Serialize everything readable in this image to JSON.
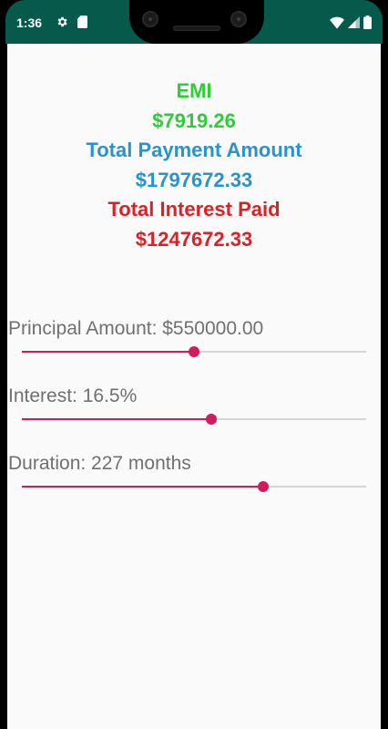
{
  "status_bar": {
    "time": "1:36",
    "icons": [
      "gear-icon",
      "sim-card-icon",
      "wifi-icon",
      "signal-icon",
      "battery-icon"
    ]
  },
  "results": {
    "emi_label": "EMI",
    "emi_value": "$7919.26",
    "total_payment_label": "Total Payment Amount",
    "total_payment_value": "$1797672.33",
    "total_interest_label": "Total Interest Paid",
    "total_interest_value": "$1247672.33"
  },
  "colors": {
    "status_bar": "#065a4b",
    "emi": "#2fcc3b",
    "total_payment": "#2a93cb",
    "total_interest": "#de1f26",
    "slider_accent": "#c8215a"
  },
  "sliders": {
    "principal": {
      "label": "Principal Amount: $550000.00",
      "fraction": 0.5
    },
    "interest": {
      "label": "Interest: 16.5%",
      "fraction": 0.55
    },
    "duration": {
      "label": "Duration: 227 months",
      "fraction": 0.7
    }
  }
}
